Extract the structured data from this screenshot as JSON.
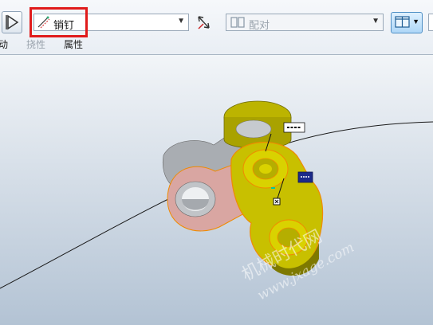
{
  "toolbar": {
    "constraint_value": "销钉",
    "alignment_value": "配对"
  },
  "tabs": {
    "move_label": "动",
    "flexibility_label": "挠性",
    "properties_label": "属性"
  },
  "watermark": {
    "line1": "机械时代网",
    "line2": "www.jxage.com"
  },
  "colors": {
    "highlight_border": "#e01b1b",
    "selected_part": "#c8c000",
    "grey_part": "#b9bcc0",
    "pink_part": "#d9a6a2",
    "edge_orange": "#f08a00",
    "callout_navy": "#1c2a8a"
  }
}
